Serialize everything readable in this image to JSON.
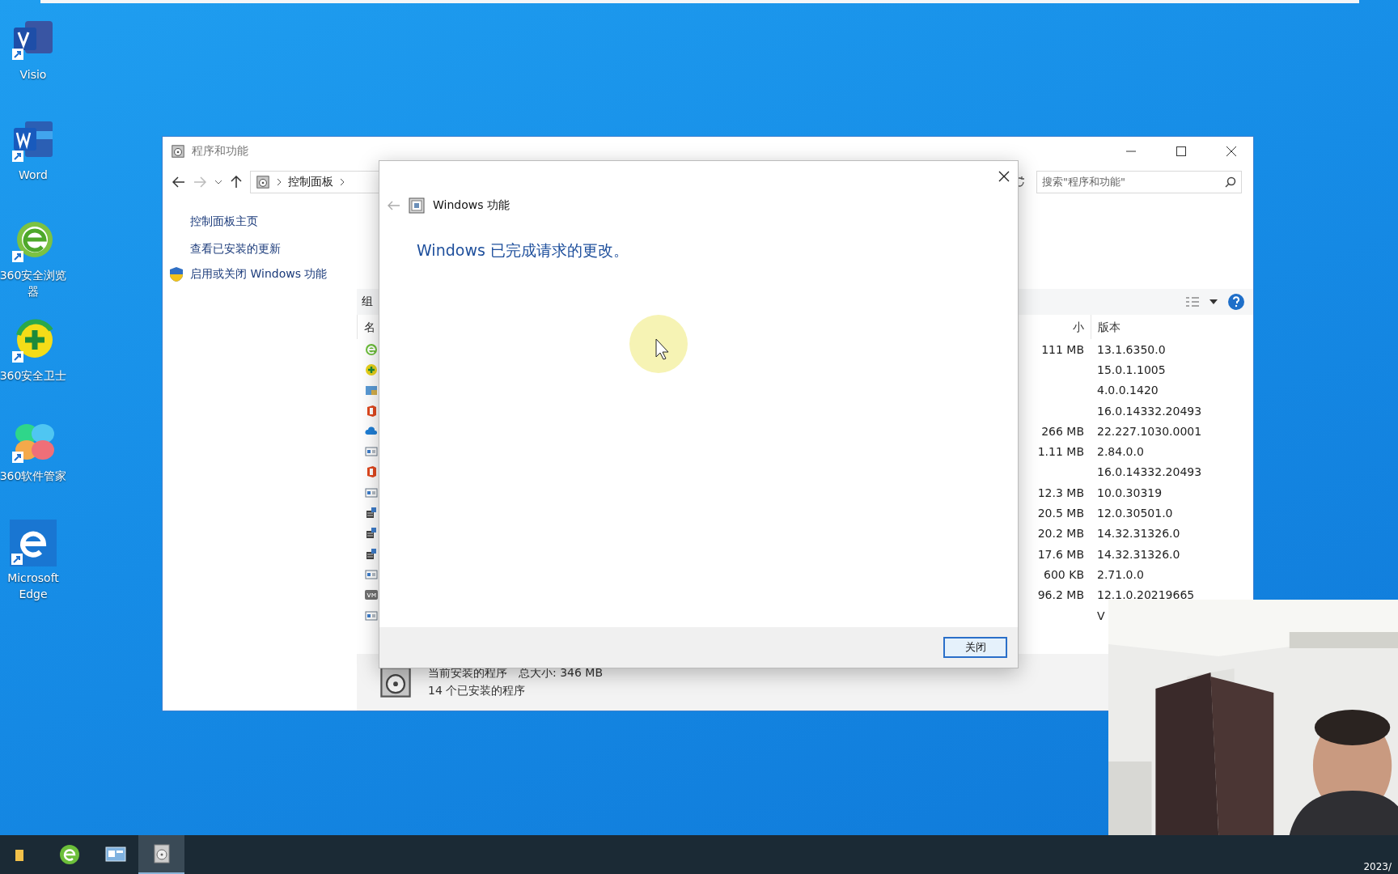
{
  "desktop_icons": [
    {
      "kind": "visio",
      "label": "Visio"
    },
    {
      "kind": "word",
      "label": "Word"
    },
    {
      "kind": "browser",
      "label": "360安全浏览器"
    },
    {
      "kind": "guard",
      "label": "360安全卫士"
    },
    {
      "kind": "manager",
      "label": "360软件管家"
    },
    {
      "kind": "edge",
      "label": "Microsoft Edge"
    }
  ],
  "window": {
    "title": "程序和功能",
    "breadcrumb": [
      "控制面板"
    ],
    "search": {
      "placeholder": "搜索\"程序和功能\""
    },
    "sidebar": {
      "links": [
        "控制面板主页",
        "查看已安装的更新"
      ],
      "feature_link": "启用或关闭 Windows 功能"
    },
    "toolbar": {
      "organize": "组"
    },
    "columns": [
      "名",
      "小",
      "版本"
    ],
    "rows": [
      {
        "kind": "browser",
        "size": "111 MB",
        "version": "13.1.6350.0"
      },
      {
        "kind": "guard",
        "version": "15.0.1.1005"
      },
      {
        "kind": "folder",
        "version": "4.0.0.1420"
      },
      {
        "kind": "office",
        "version": "16.0.14332.20493"
      },
      {
        "kind": "cloud",
        "size": "266 MB",
        "version": "22.227.1030.0001"
      },
      {
        "kind": "installer",
        "size": "1.11 MB",
        "version": "2.84.0.0"
      },
      {
        "kind": "office",
        "version": "16.0.14332.20493"
      },
      {
        "kind": "installer",
        "size": "12.3 MB",
        "version": "10.0.30319"
      },
      {
        "kind": "redist",
        "size": "20.5 MB",
        "version": "12.0.30501.0"
      },
      {
        "kind": "redist",
        "size": "20.2 MB",
        "version": "14.32.31326.0"
      },
      {
        "kind": "redist",
        "size": "17.6 MB",
        "version": "14.32.31326.0"
      },
      {
        "kind": "installer",
        "size": "600 KB",
        "version": "2.71.0.0"
      },
      {
        "kind": "vm",
        "size": "96.2 MB",
        "version": "12.1.0.20219665"
      },
      {
        "kind": "installer",
        "version": "V"
      }
    ],
    "status": {
      "title": "当前安装的程序",
      "total": "总大小: 346 MB",
      "count": "14 个已安装的程序"
    }
  },
  "dialog": {
    "title": "Windows 功能",
    "message": "Windows 已完成请求的更改。",
    "button": "关闭"
  },
  "taskbar": {
    "apps": [
      {
        "kind": "folder",
        "selected": false
      },
      {
        "kind": "browser",
        "selected": false
      },
      {
        "kind": "panel",
        "selected": false
      },
      {
        "kind": "programs",
        "selected": true
      }
    ],
    "clock": "2023/"
  }
}
